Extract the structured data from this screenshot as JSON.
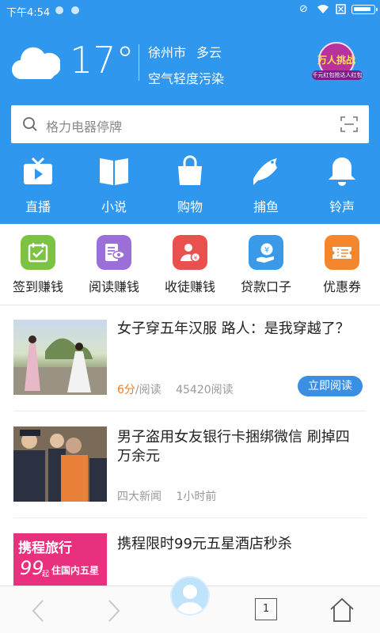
{
  "status": {
    "time": "下午4:54",
    "battery_level": 0.9
  },
  "weather": {
    "temperature": "17°",
    "city": "徐州市",
    "condition": "多云",
    "air_quality": "空气轻度污染"
  },
  "promo_badge": {
    "text": "万人挑战",
    "subtext": "千元红包抢达人红包"
  },
  "search": {
    "placeholder": "格力电器停牌"
  },
  "quick_nav": [
    {
      "label": "直播",
      "icon": "tv-play-icon"
    },
    {
      "label": "小说",
      "icon": "book-icon"
    },
    {
      "label": "购物",
      "icon": "shopping-bag-icon"
    },
    {
      "label": "捕鱼",
      "icon": "fish-icon"
    },
    {
      "label": "铃声",
      "icon": "bell-icon"
    }
  ],
  "feature_grid": [
    {
      "label": "签到赚钱",
      "icon": "calendar-check-icon",
      "color": "#7cc243"
    },
    {
      "label": "阅读赚钱",
      "icon": "read-eye-icon",
      "color": "#9b6fd8"
    },
    {
      "label": "收徒赚钱",
      "icon": "user-coin-icon",
      "color": "#e9514f"
    },
    {
      "label": "贷款口子",
      "icon": "money-hand-icon",
      "color": "#3b9ae8"
    },
    {
      "label": "优惠券",
      "icon": "coupon-icon",
      "color": "#f4872e"
    }
  ],
  "news": [
    {
      "title": "女子穿五年汉服 路人：是我穿越了？",
      "score": "6分",
      "score_suffix": "/阅读",
      "reads": "45420阅读",
      "action": "立即阅读"
    },
    {
      "title": "男子盗用女友银行卡捆绑微信 刷掉四万余元",
      "source": "四大新闻",
      "time": "1小时前"
    },
    {
      "title": "携程限时99元五星酒店秒杀",
      "ad_brand": "携程旅行",
      "ad_price": "99",
      "ad_unit": "起",
      "ad_text": "住国内五星"
    }
  ],
  "bottom_bar": {
    "tab_count": "1"
  }
}
